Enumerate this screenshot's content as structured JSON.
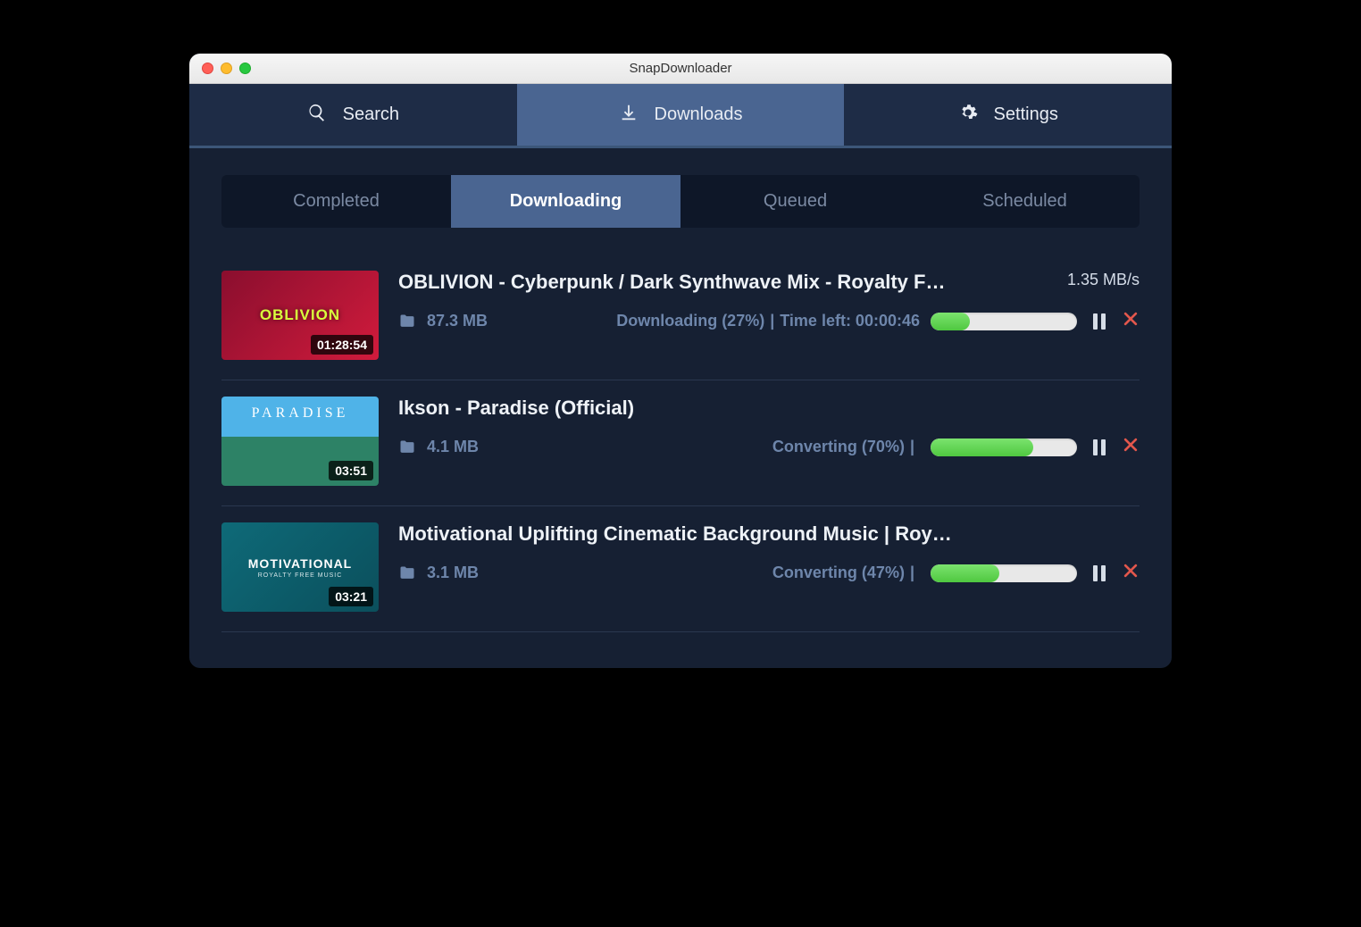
{
  "window": {
    "title": "SnapDownloader"
  },
  "mainTabs": {
    "search": "Search",
    "downloads": "Downloads",
    "settings": "Settings",
    "activeIndex": 1
  },
  "subTabs": {
    "items": [
      "Completed",
      "Downloading",
      "Queued",
      "Scheduled"
    ],
    "activeIndex": 1
  },
  "downloads": [
    {
      "title": "OBLIVION - Cyberpunk / Dark Synthwave Mix - Royalty F…",
      "duration": "01:28:54",
      "size": "87.3 MB",
      "status": "Downloading (27%)",
      "timeLeftLabel": "Time left: 00:00:46",
      "speed": "1.35 MB/s",
      "progressPct": 27,
      "hasTimeLeft": true
    },
    {
      "title": "Ikson - Paradise (Official)",
      "duration": "03:51",
      "size": "4.1 MB",
      "status": "Converting (70%)",
      "timeLeftLabel": "",
      "speed": "",
      "progressPct": 70,
      "hasTimeLeft": false
    },
    {
      "title": "Motivational Uplifting Cinematic Background Music | Roy…",
      "duration": "03:21",
      "size": "3.1 MB",
      "status": "Converting (47%)",
      "timeLeftLabel": "",
      "speed": "",
      "progressPct": 47,
      "hasTimeLeft": false
    }
  ]
}
